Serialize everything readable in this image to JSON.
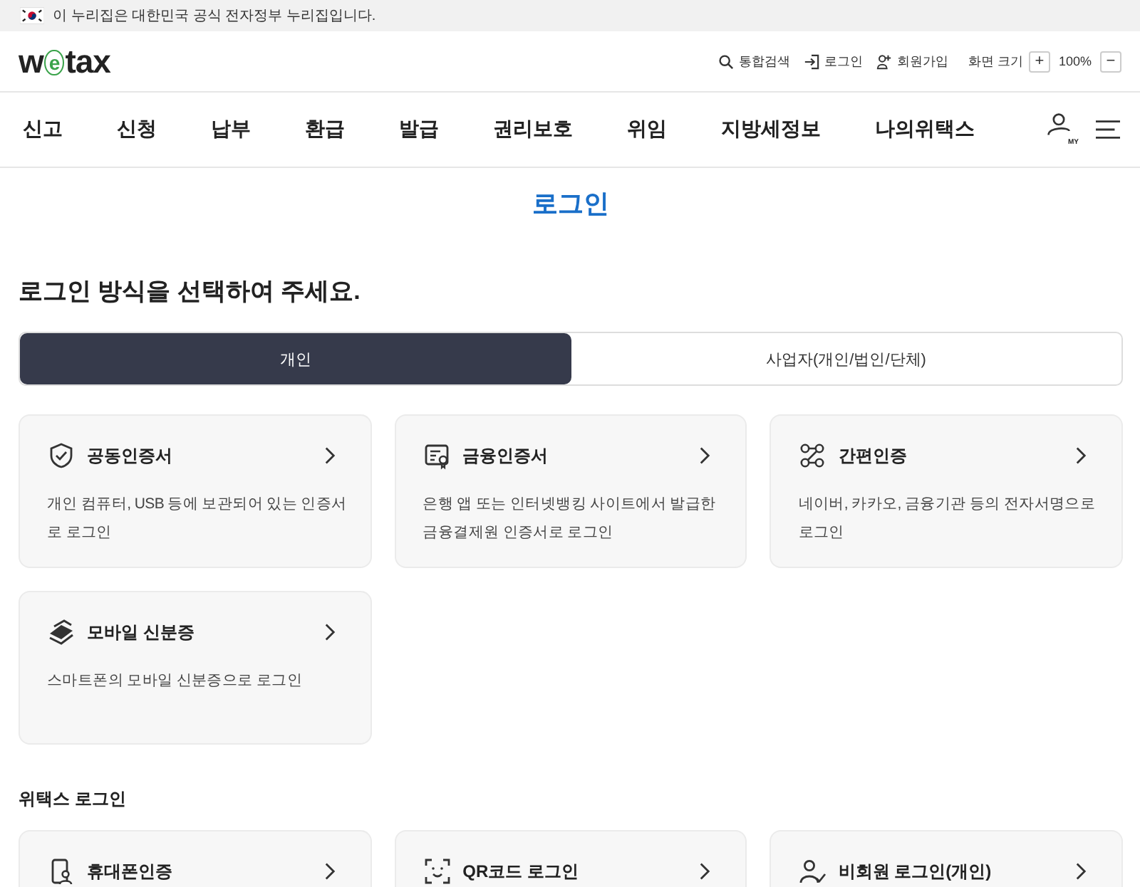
{
  "gov_banner": {
    "text": "이 누리집은 대한민국 공식 전자정부 누리집입니다."
  },
  "logo": [
    {
      "text": "w",
      "accent": false
    },
    {
      "text": "e",
      "accent": true
    },
    {
      "text": "tax",
      "accent": false
    }
  ],
  "utility_links": [
    {
      "kind": "search",
      "label": "통합검색"
    },
    {
      "kind": "login",
      "label": "로그인"
    },
    {
      "kind": "join",
      "label": "회원가입"
    }
  ],
  "zoom": {
    "label": "화면 크기",
    "increase": "+",
    "value": "100%",
    "decrease": "−"
  },
  "nav": [
    "신고",
    "신청",
    "납부",
    "환급",
    "발급",
    "권리보호",
    "위임",
    "지방세정보",
    "나의위택스"
  ],
  "my_badge": "MY",
  "page_title": "로그인",
  "heading": "로그인 방식을 선택하여 주세요.",
  "tabs": [
    {
      "label": "개인",
      "selected": true
    },
    {
      "label": "사업자(개인/법인/단체)",
      "selected": false
    }
  ],
  "methods": [
    {
      "kind": "shield",
      "title": "공동인증서",
      "desc": "개인 컴퓨터, USB 등에 보관되어 있는 인증서로 로그인"
    },
    {
      "kind": "certificate",
      "title": "금융인증서",
      "desc": "은행 앱 또는 인터넷뱅킹 사이트에서 발급한 금융결제원 인증서로 로그인"
    },
    {
      "kind": "nodes",
      "title": "간편인증",
      "desc": "네이버, 카카오, 금융기관 등의 전자서명으로 로그인"
    },
    {
      "kind": "layers",
      "title": "모바일 신분증",
      "desc": "스마트폰의 모바일 신분증으로 로그인"
    }
  ],
  "wetax_section": {
    "title": "위택스 로그인",
    "methods": [
      {
        "kind": "phone",
        "title": "휴대폰인증"
      },
      {
        "kind": "qr",
        "title": "QR코드 로그인"
      },
      {
        "kind": "user",
        "title": "비회원 로그인(개인)"
      }
    ]
  }
}
